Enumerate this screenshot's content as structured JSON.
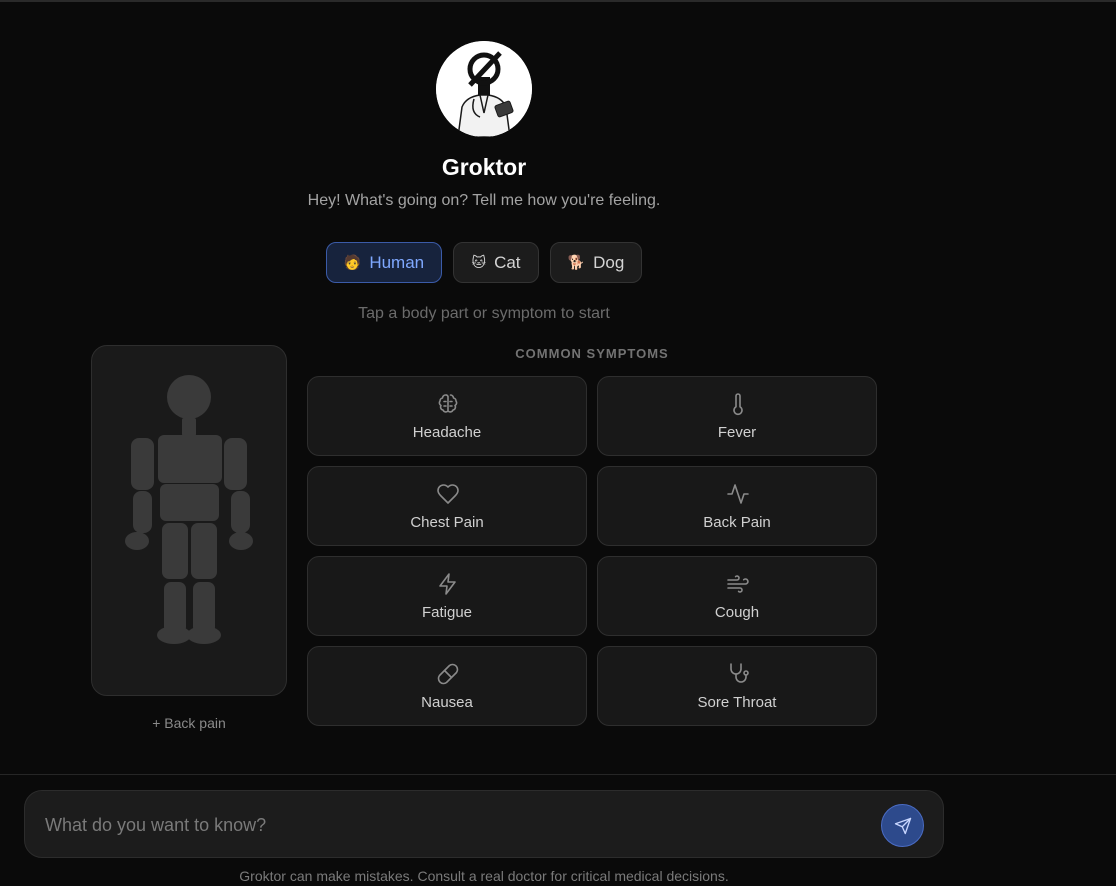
{
  "brand": {
    "name": "Groktor",
    "greeting": "Hey! What's going on? Tell me how you're feeling."
  },
  "species": [
    {
      "emoji": "🧑",
      "label": "Human",
      "active": true
    },
    {
      "emoji": "🐱",
      "label": "Cat",
      "active": false
    },
    {
      "emoji": "🐕",
      "label": "Dog",
      "active": false
    }
  ],
  "hint": "Tap a body part or symptom to start",
  "body_map": {
    "selected_caption": "+ Back pain"
  },
  "symptoms": {
    "title": "COMMON SYMPTOMS",
    "items": [
      {
        "label": "Headache",
        "icon": "brain-icon"
      },
      {
        "label": "Fever",
        "icon": "thermometer-icon"
      },
      {
        "label": "Chest Pain",
        "icon": "heart-icon"
      },
      {
        "label": "Back Pain",
        "icon": "activity-icon"
      },
      {
        "label": "Fatigue",
        "icon": "lightning-icon"
      },
      {
        "label": "Cough",
        "icon": "wind-icon"
      },
      {
        "label": "Nausea",
        "icon": "pill-icon"
      },
      {
        "label": "Sore Throat",
        "icon": "stethoscope-icon"
      }
    ]
  },
  "composer": {
    "placeholder": "What do you want to know?",
    "value": ""
  },
  "disclaimer": "Groktor can make mistakes. Consult a real doctor for critical medical decisions.",
  "colors": {
    "background": "#0a0a0a",
    "accent": "#3b5ba8",
    "accent_text": "#7fa8ff",
    "card": "#181818"
  }
}
